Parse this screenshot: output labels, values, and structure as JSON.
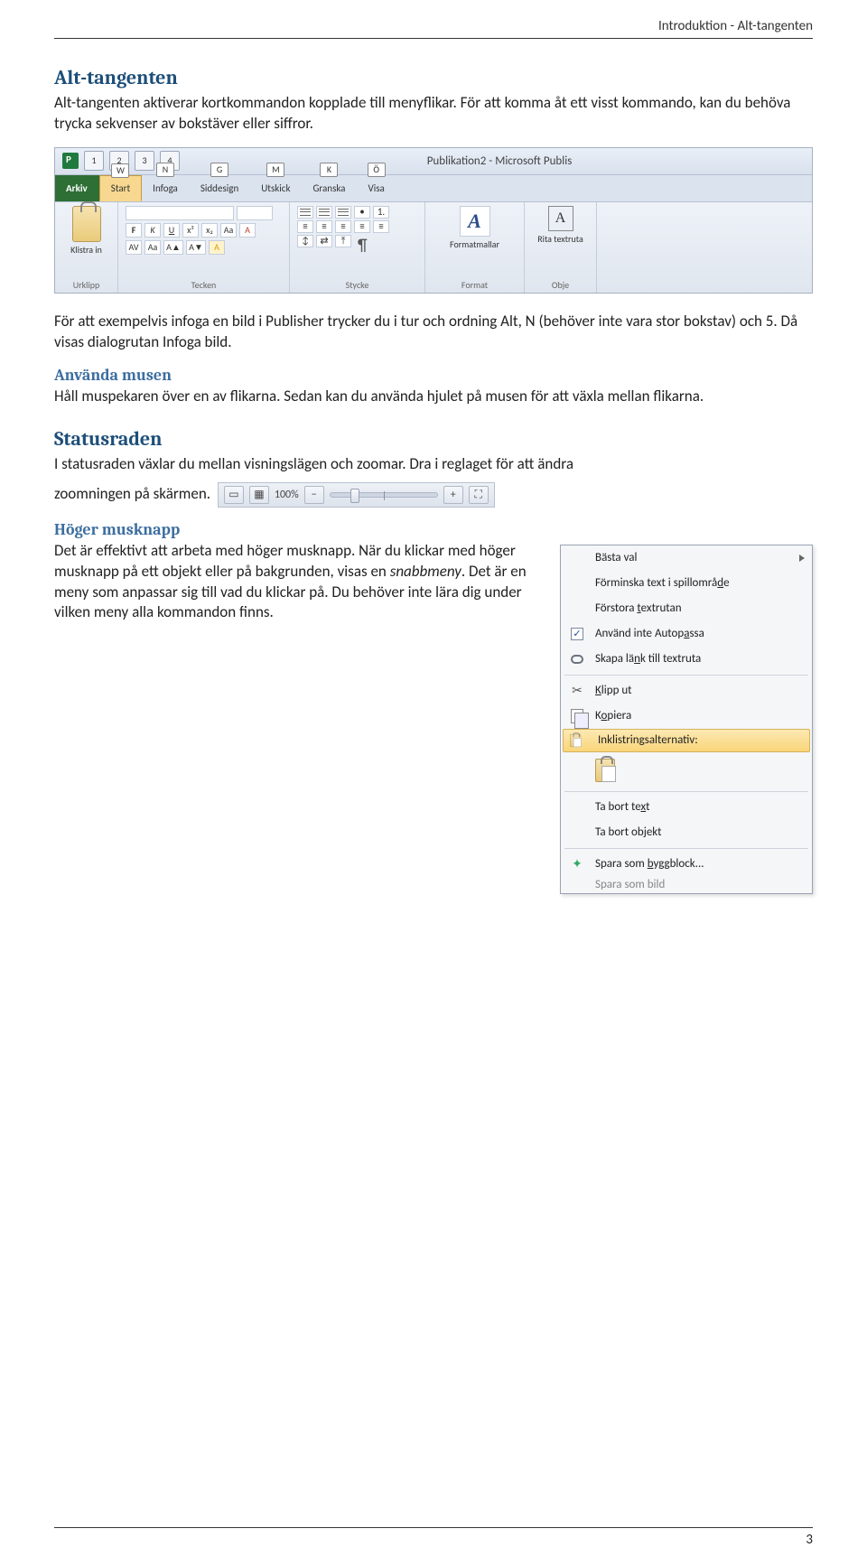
{
  "header": {
    "breadcrumb": "Introduktion - Alt-tangenten"
  },
  "s1": {
    "title": "Alt-tangenten",
    "p1a": "Alt-tangenten aktiverar kortkommandon kopplade till menyflikar. För att komma åt ett visst kommando, kan du behöva trycka sekvenser av bokstäver eller siffror."
  },
  "ribbon": {
    "title": "Publikation2 - Microsoft Publis",
    "qat_keys": [
      "1",
      "2",
      "3",
      "4"
    ],
    "tabs": [
      {
        "label": "Arkiv",
        "key": ""
      },
      {
        "label": "Start",
        "key": "W"
      },
      {
        "label": "Infoga",
        "key": "N"
      },
      {
        "label": "Siddesign",
        "key": "G"
      },
      {
        "label": "Utskick",
        "key": "M"
      },
      {
        "label": "Granska",
        "key": "K"
      },
      {
        "label": "Visa",
        "key": "Ö"
      }
    ],
    "groups": {
      "urklipp": "Urklipp",
      "klistra": "Klistra in",
      "tecken": "Tecken",
      "stycke": "Stycke",
      "format": "Format",
      "formatmallar": "Formatmallar",
      "rita": "Rita textruta",
      "obje": "Obje"
    }
  },
  "s1b": {
    "p": "För att exempelvis infoga en bild i Publisher trycker du i tur och ordning Alt, N (behöver inte vara stor bokstav) och 5. Då visas dialogrutan Infoga bild."
  },
  "s2": {
    "title": "Använda musen",
    "p": "Håll muspekaren över en av flikarna. Sedan kan du använda hjulet på musen för att växla mellan flikarna."
  },
  "s3": {
    "title": "Statusraden",
    "p1": "I statusraden växlar du mellan visningslägen och zoomar. Dra i reglaget för att ändra",
    "p2": "zoomningen på skärmen.",
    "zoom": "100%"
  },
  "s4": {
    "title": "Höger musknapp",
    "p_a": "Det är effektivt att arbeta med höger musknapp. När du klickar med höger musknapp på ett objekt eller på bakgrunden, visas en ",
    "p_it": "snabbmeny",
    "p_b": ". Det är en meny som anpassar sig till vad du klickar på. Du behöver inte lära dig under vilken meny alla kommandon finns."
  },
  "ctx": {
    "items": [
      {
        "kind": "sub",
        "label": "Bästa val"
      },
      {
        "kind": "item",
        "label_pre": "Förminska text i spillområ",
        "mnem": "d",
        "label_post": "e"
      },
      {
        "kind": "item",
        "label_pre": "Förstora ",
        "mnem": "t",
        "label_post": "extrutan"
      },
      {
        "kind": "check",
        "checked": true,
        "label_pre": "Använd inte Autop",
        "mnem": "a",
        "label_post": "ssa"
      },
      {
        "kind": "icon",
        "icon": "link",
        "label_pre": "Skapa lä",
        "mnem": "n",
        "label_post": "k till textruta"
      },
      {
        "kind": "sep"
      },
      {
        "kind": "icon",
        "icon": "cut",
        "label_pre": "",
        "mnem": "K",
        "label_post": "lipp ut"
      },
      {
        "kind": "icon",
        "icon": "copy",
        "label_pre": "K",
        "mnem": "o",
        "label_post": "piera"
      },
      {
        "kind": "hl",
        "icon": "paste",
        "label": "Inklistringsalternativ:"
      },
      {
        "kind": "bigpaste"
      },
      {
        "kind": "sep"
      },
      {
        "kind": "item",
        "label_pre": "Ta bort te",
        "mnem": "x",
        "label_post": "t"
      },
      {
        "kind": "item",
        "label_pre": "Ta bort ob",
        "mnem": "j",
        "label_post": "ekt"
      },
      {
        "kind": "sep"
      },
      {
        "kind": "icon",
        "icon": "star",
        "label_pre": "Spara som ",
        "mnem": "b",
        "label_post": "yggblock..."
      },
      {
        "kind": "cut",
        "label": "Spara som bild"
      }
    ]
  },
  "footer": {
    "page": "3"
  }
}
